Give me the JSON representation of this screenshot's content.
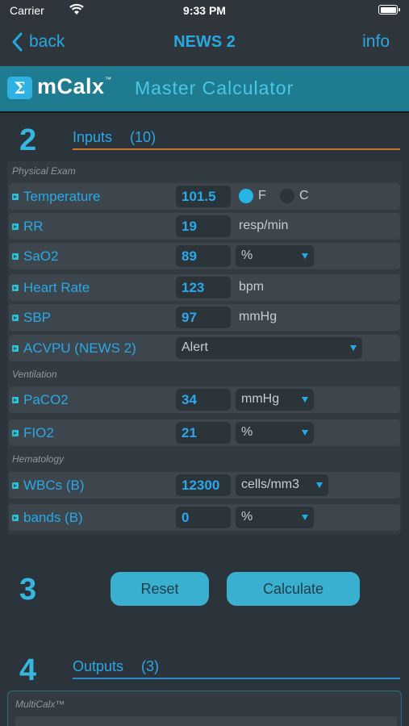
{
  "status": {
    "carrier": "Carrier",
    "time": "9:33 PM"
  },
  "nav": {
    "back": "back",
    "title": "NEWS 2",
    "info": "info"
  },
  "brand": {
    "logo_symbol": "Σ",
    "logo_text": "mCalx",
    "tm": "™",
    "subtitle": "Master Calculator"
  },
  "inputs": {
    "number": "2",
    "title": "Inputs",
    "count": "(10)"
  },
  "categories": {
    "physical": "Physical Exam",
    "ventilation": "Ventilation",
    "hematology": "Hematology"
  },
  "fields": {
    "temperature": {
      "label": "Temperature",
      "value": "101.5",
      "unit_f": "F",
      "unit_c": "C",
      "selected": "F"
    },
    "rr": {
      "label": "RR",
      "value": "19",
      "unit": "resp/min"
    },
    "sao2": {
      "label": "SaO2",
      "value": "89",
      "unit": "%"
    },
    "heart_rate": {
      "label": "Heart Rate",
      "value": "123",
      "unit": "bpm"
    },
    "sbp": {
      "label": "SBP",
      "value": "97",
      "unit": "mmHg"
    },
    "acvpu": {
      "label": "ACVPU (NEWS 2)",
      "value": "Alert"
    },
    "paco2": {
      "label": "PaCO2",
      "value": "34",
      "unit": "mmHg"
    },
    "fio2": {
      "label": "FIO2",
      "value": "21",
      "unit": "%"
    },
    "wbcs": {
      "label": "WBCs (B)",
      "value": "12300",
      "unit": "cells/mm3"
    },
    "bands": {
      "label": "bands (B)",
      "value": "0",
      "unit": "%"
    }
  },
  "actions": {
    "number": "3",
    "reset": "Reset",
    "calculate": "Calculate"
  },
  "outputs": {
    "number": "4",
    "title": "Outputs",
    "count": "(3)",
    "group": "MultiCalx™"
  },
  "colors": {
    "accent": "#28a8e0",
    "banner": "#1f7b8f",
    "button": "#3ab0d0",
    "section_line_inputs": "#c8782a",
    "section_line_outputs": "#2a8cc8"
  }
}
